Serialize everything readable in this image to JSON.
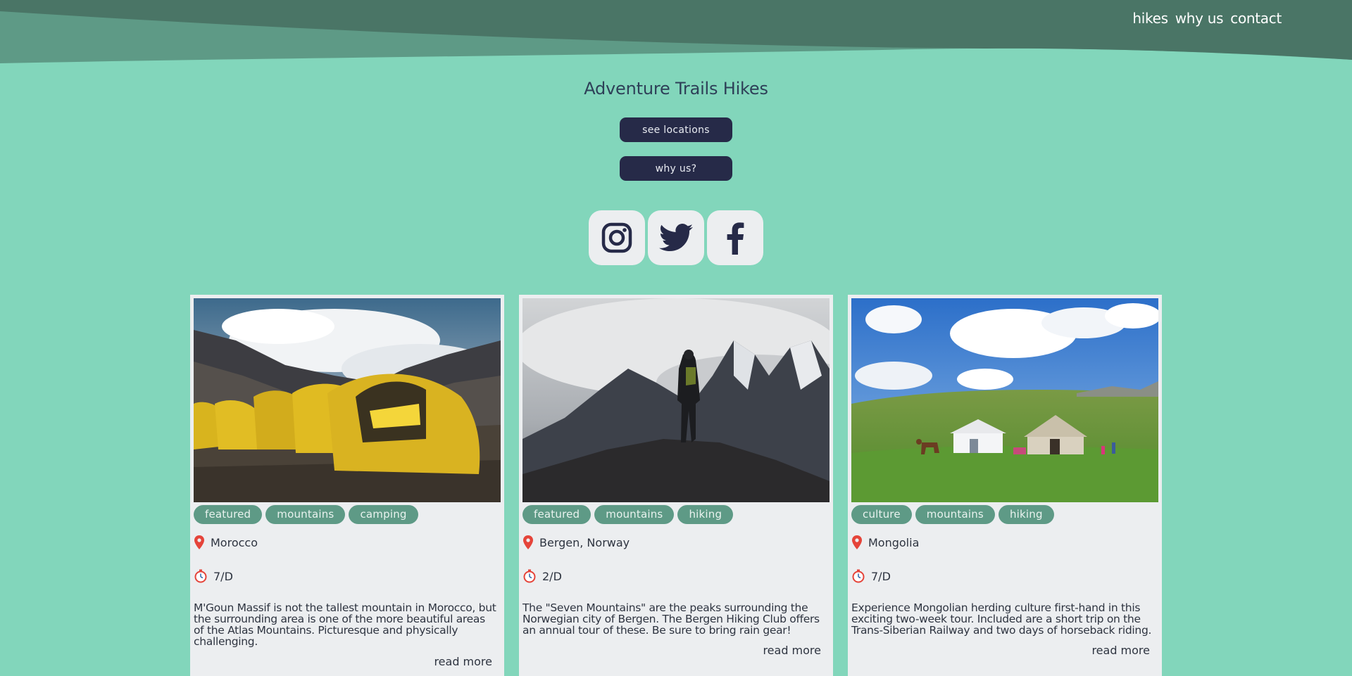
{
  "nav": {
    "items": [
      {
        "label": "hikes"
      },
      {
        "label": "why us"
      },
      {
        "label": "contact"
      }
    ]
  },
  "hero": {
    "title": "Adventure Trails Hikes",
    "see_locations_label": "see locations",
    "why_us_label": "why us?"
  },
  "socials": [
    {
      "icon": "instagram-icon"
    },
    {
      "icon": "twitter-icon"
    },
    {
      "icon": "facebook-icon"
    }
  ],
  "colors": {
    "background": "#82d6bb",
    "wave_dark": "#4a7566",
    "wave_light": "#5e9a86",
    "button": "#262a48",
    "tag": "#5e9a86",
    "card": "#eceef0",
    "pin": "#e5443a"
  },
  "cards": [
    {
      "image": "yellow tents in rocky mountain valley",
      "tags": [
        "featured",
        "mountains",
        "camping"
      ],
      "location": "Morocco",
      "duration": "7/D",
      "description": "M'Goun Massif is not the tallest mountain in Morocco, but the surrounding area is one of the more beautiful areas of the Atlas Mountains. Picturesque and physically challenging.",
      "read_more": "read more"
    },
    {
      "image": "hiker silhouette on misty mountain peaks",
      "tags": [
        "featured",
        "mountains",
        "hiking"
      ],
      "location": "Bergen, Norway",
      "duration": "2/D",
      "description": "The \"Seven Mountains\" are the peaks surrounding the Norwegian city of Bergen. The Bergen Hiking Club offers an annual tour of these. Be sure to bring rain gear!",
      "read_more": "read more"
    },
    {
      "image": "yurts on green steppe under blue sky",
      "tags": [
        "culture",
        "mountains",
        "hiking"
      ],
      "location": "Mongolia",
      "duration": "7/D",
      "description": "Experience Mongolian herding culture first-hand in this exciting two-week tour. Included are a short trip on the Trans-Siberian Railway and two days of horseback riding.",
      "read_more": "read more"
    }
  ]
}
